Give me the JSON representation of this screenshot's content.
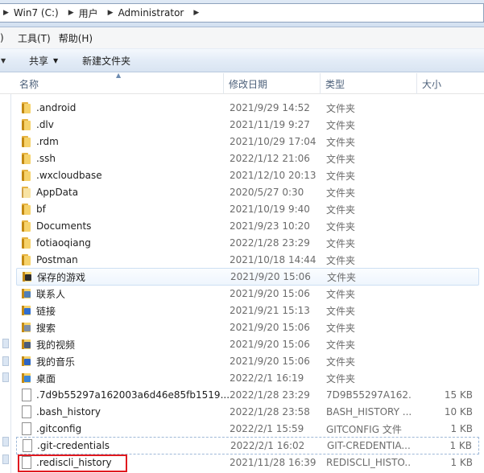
{
  "address": {
    "crumbs": [
      "Win7 (C:)",
      "用户",
      "Administrator"
    ]
  },
  "menu": {
    "items": [
      ")",
      "工具(T)",
      "帮助(H)"
    ]
  },
  "commands": {
    "share_label": "共享",
    "new_folder_label": "新建文件夹"
  },
  "columns": {
    "name": "名称",
    "date": "修改日期",
    "type": "类型",
    "size": "大小"
  },
  "files": [
    {
      "name": ".android",
      "date": "2021/9/29 14:52",
      "type": "文件夹",
      "size": "",
      "icon": "folder-icon"
    },
    {
      "name": ".dlv",
      "date": "2021/11/19 9:27",
      "type": "文件夹",
      "size": "",
      "icon": "folder-icon"
    },
    {
      "name": ".rdm",
      "date": "2021/10/29 17:04",
      "type": "文件夹",
      "size": "",
      "icon": "folder-icon"
    },
    {
      "name": ".ssh",
      "date": "2022/1/12 21:06",
      "type": "文件夹",
      "size": "",
      "icon": "folder-icon"
    },
    {
      "name": ".wxcloudbase",
      "date": "2021/12/10 20:13",
      "type": "文件夹",
      "size": "",
      "icon": "folder-icon"
    },
    {
      "name": "AppData",
      "date": "2020/5/27 0:30",
      "type": "文件夹",
      "size": "",
      "icon": "folder-icon"
    },
    {
      "name": "bf",
      "date": "2021/10/19 9:40",
      "type": "文件夹",
      "size": "",
      "icon": "folder-icon"
    },
    {
      "name": "Documents",
      "date": "2021/9/23 10:20",
      "type": "文件夹",
      "size": "",
      "icon": "folder-icon"
    },
    {
      "name": "fotiaoqiang",
      "date": "2022/1/28 23:29",
      "type": "文件夹",
      "size": "",
      "icon": "folder-icon"
    },
    {
      "name": "Postman",
      "date": "2021/10/18 14:44",
      "type": "文件夹",
      "size": "",
      "icon": "folder-icon"
    },
    {
      "name": "保存的游戏",
      "date": "2021/9/20 15:06",
      "type": "文件夹",
      "size": "",
      "icon": "saved-games-icon"
    },
    {
      "name": "联系人",
      "date": "2021/9/20 15:06",
      "type": "文件夹",
      "size": "",
      "icon": "contacts-icon"
    },
    {
      "name": "链接",
      "date": "2021/9/21 15:13",
      "type": "文件夹",
      "size": "",
      "icon": "links-icon"
    },
    {
      "name": "搜索",
      "date": "2021/9/20 15:06",
      "type": "文件夹",
      "size": "",
      "icon": "searches-icon"
    },
    {
      "name": "我的视频",
      "date": "2021/9/20 15:06",
      "type": "文件夹",
      "size": "",
      "icon": "videos-icon"
    },
    {
      "name": "我的音乐",
      "date": "2021/9/20 15:06",
      "type": "文件夹",
      "size": "",
      "icon": "music-icon"
    },
    {
      "name": "桌面",
      "date": "2022/2/1 16:19",
      "type": "文件夹",
      "size": "",
      "icon": "desktop-icon"
    },
    {
      "name": ".7d9b55297a162003a6d46e85fb1519...",
      "date": "2022/1/28 23:29",
      "type": "7D9B55297A162...",
      "size": "15 KB",
      "icon": "file-icon"
    },
    {
      "name": ".bash_history",
      "date": "2022/1/28 23:58",
      "type": "BASH_HISTORY ...",
      "size": "10 KB",
      "icon": "file-icon"
    },
    {
      "name": ".gitconfig",
      "date": "2022/2/1 15:59",
      "type": "GITCONFIG 文件",
      "size": "1 KB",
      "icon": "file-icon"
    },
    {
      "name": ".git-credentials",
      "date": "2022/2/1 16:02",
      "type": "GIT-CREDENTIA...",
      "size": "1 KB",
      "icon": "file-icon"
    },
    {
      "name": ".rediscli_history",
      "date": "2021/11/28 16:39",
      "type": "REDISCLI_HISTO...",
      "size": "1 KB",
      "icon": "file-icon"
    }
  ]
}
